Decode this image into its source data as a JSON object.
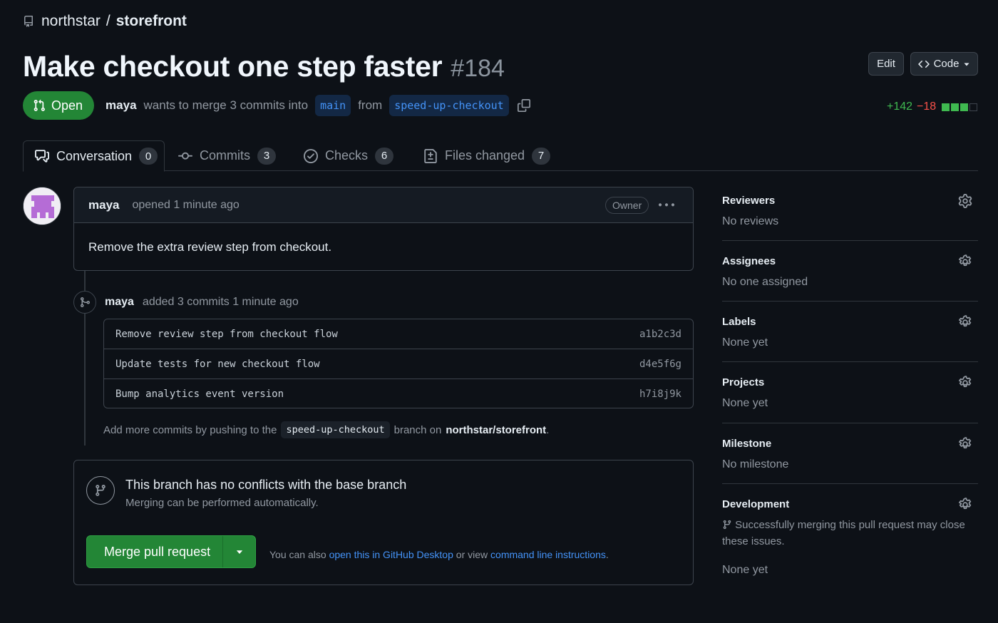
{
  "repo": {
    "owner": "northstar",
    "separator": "/",
    "name": "storefront"
  },
  "pr": {
    "title": "Make checkout one step faster",
    "number": "#184",
    "state": "Open",
    "author": "maya",
    "merge_text": "wants to merge 3 commits into",
    "base_branch": "main",
    "from_text": "from",
    "head_branch": "speed-up-checkout",
    "additions": "+142",
    "deletions": "−18"
  },
  "header_buttons": {
    "edit": "Edit",
    "code": "Code"
  },
  "tabs": [
    {
      "label": "Conversation",
      "count": "0",
      "icon": "comment-discussion-icon"
    },
    {
      "label": "Commits",
      "count": "3",
      "icon": "git-commit-icon"
    },
    {
      "label": "Checks",
      "count": "6",
      "icon": "check-circle-icon"
    },
    {
      "label": "Files changed",
      "count": "7",
      "icon": "file-diff-icon"
    }
  ],
  "comment": {
    "author": "maya",
    "meta": "opened 1 minute ago",
    "badge": "Owner",
    "body": "Remove the extra review step from checkout."
  },
  "commit_event": {
    "author": "maya",
    "text": "added 3 commits 1 minute ago",
    "commits": [
      {
        "message": "Remove review step from checkout flow",
        "sha": "a1b2c3d"
      },
      {
        "message": "Update tests for new checkout flow",
        "sha": "d4e5f6g"
      },
      {
        "message": "Bump analytics event version",
        "sha": "h7i8j9k"
      }
    ],
    "hint_prefix": "Add more commits by pushing to the",
    "hint_branch": "speed-up-checkout",
    "hint_mid": "branch on",
    "hint_repo": "northstar/storefront",
    "hint_suffix": "."
  },
  "merge": {
    "title": "This branch has no conflicts with the base branch",
    "subtitle": "Merging can be performed automatically.",
    "button": "Merge pull request",
    "hint_prefix": "You can also",
    "hint_link1": "open this in GitHub Desktop",
    "hint_mid": "or view",
    "hint_link2": "command line instructions",
    "hint_suffix": "."
  },
  "sidebar": {
    "reviewers": {
      "title": "Reviewers",
      "value": "No reviews"
    },
    "assignees": {
      "title": "Assignees",
      "value": "No one assigned"
    },
    "labels": {
      "title": "Labels",
      "value": "None yet"
    },
    "projects": {
      "title": "Projects",
      "value": "None yet"
    },
    "milestone": {
      "title": "Milestone",
      "value": "No milestone"
    },
    "development": {
      "title": "Development",
      "text": "Successfully merging this pull request may close these issues.",
      "value": "None yet"
    }
  },
  "colors": {
    "background": "#0d1117",
    "open_green": "#238636",
    "link_blue": "#4493f8",
    "add_green": "#3fb950",
    "del_red": "#f85149"
  }
}
